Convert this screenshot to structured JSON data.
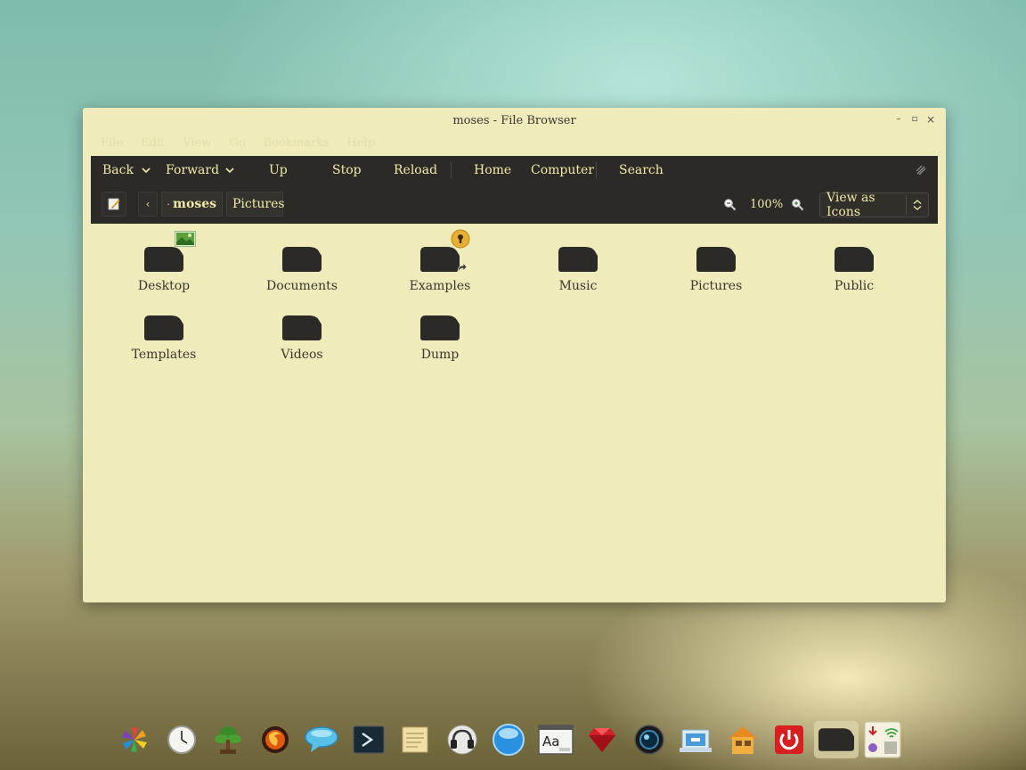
{
  "window": {
    "title": "moses - File Browser",
    "minimize_glyph": "–",
    "maximize_glyph": "▫",
    "close_glyph": "×"
  },
  "menubar": [
    "File",
    "Edit",
    "View",
    "Go",
    "Bookmarks",
    "Help"
  ],
  "toolbar": {
    "back": "Back",
    "forward": "Forward",
    "up": "Up",
    "stop": "Stop",
    "reload": "Reload",
    "home": "Home",
    "computer": "Computer",
    "search": "Search"
  },
  "location": {
    "back_glyph": "‹",
    "crumbs": [
      "moses",
      "Pictures"
    ],
    "zoom": "100%",
    "view_mode": "View as Icons"
  },
  "folders": [
    {
      "label": "Desktop",
      "emblem": "picture-emblem"
    },
    {
      "label": "Documents",
      "emblem": ""
    },
    {
      "label": "Examples",
      "emblem": "lock-emblem"
    },
    {
      "label": "Music",
      "emblem": ""
    },
    {
      "label": "Pictures",
      "emblem": ""
    },
    {
      "label": "Public",
      "emblem": ""
    },
    {
      "label": "Templates",
      "emblem": ""
    },
    {
      "label": "Videos",
      "emblem": ""
    },
    {
      "label": "Dump",
      "emblem": ""
    }
  ],
  "dock": [
    "pinwheel-icon",
    "clock-icon",
    "tree-icon",
    "firefox-icon",
    "chat-icon",
    "terminal-icon",
    "notes-icon",
    "headphones-icon",
    "orb-icon",
    "font-viewer-icon",
    "ruby-icon",
    "camera-lens-icon",
    "screenshot-icon",
    "home-folder-icon",
    "power-icon",
    "folder-icon",
    "system-tray-icon"
  ],
  "colors": {
    "window_bg": "#efebbb",
    "toolbar_bg": "#2b2a27",
    "toolbar_text": "#f1eaa8",
    "folder": "#2b2a27"
  }
}
